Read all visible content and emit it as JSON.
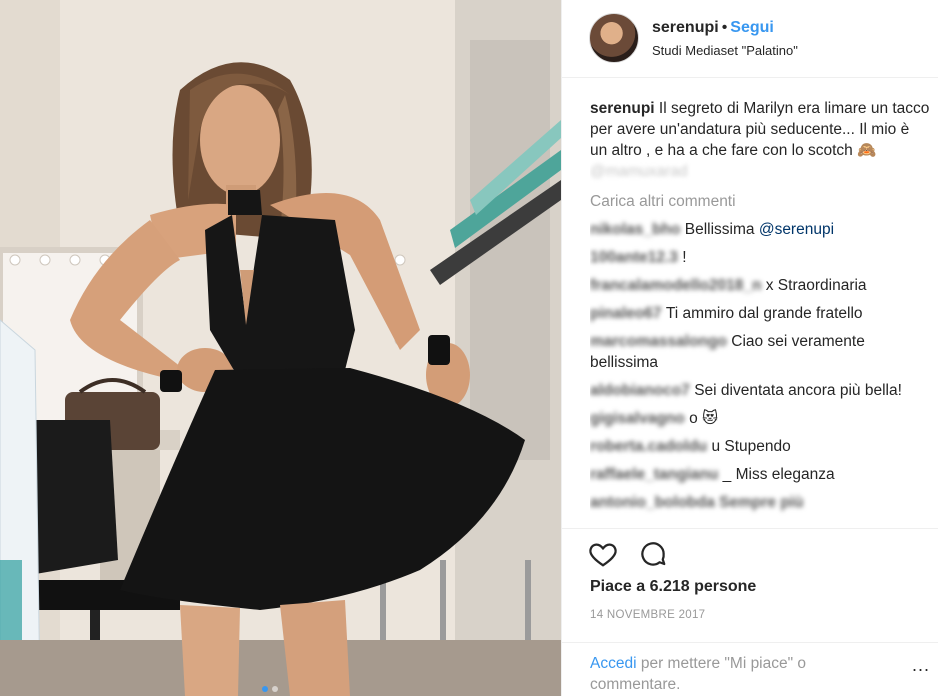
{
  "post": {
    "username": "serenupi",
    "bullet": "•",
    "follow_label": "Segui",
    "location": "Studi Mediaset \"Palatino\""
  },
  "caption": {
    "username": "serenupi",
    "text": "Il segreto di Marilyn era limare un tacco per avere un'andatura più seducente... Il mio è un altro , e ha a che fare con lo scotch 🙈",
    "mention_blurred": "@mamuxarad"
  },
  "load_more": "Carica altri commenti",
  "comments": [
    {
      "user": "nikolas_bho",
      "text": "Bellissima ",
      "mention": "@serenupi",
      "blurred_text": false
    },
    {
      "user": "100ante12.3",
      "text": "!",
      "mention": "",
      "blurred_text": false
    },
    {
      "user": "francalamodello2018_n",
      "text": "x Straordinaria",
      "mention": "",
      "blurred_text": false
    },
    {
      "user": "pinaleo67",
      "text": "Ti ammiro dal grande fratello",
      "mention": "",
      "blurred_text": false
    },
    {
      "user": "marcomassalongo",
      "text": "Ciao sei veramente bellissima",
      "mention": "",
      "blurred_text": false
    },
    {
      "user": "aldobianoco7",
      "text": "Sei diventata ancora più bella!",
      "mention": "",
      "blurred_text": false
    },
    {
      "user": "gigisalvagno",
      "text": "o 😻",
      "mention": "",
      "blurred_text": false
    },
    {
      "user": "roberta.cadoldu",
      "text": "u Stupendo",
      "mention": "",
      "blurred_text": false
    },
    {
      "user": "raffaele_tangianu",
      "text": "_ Miss eleganza",
      "mention": "",
      "blurred_text": false
    },
    {
      "user": "antonio_bolobda",
      "text": "Sempre più",
      "mention": "",
      "blurred_text": true
    }
  ],
  "actions": {
    "heart_icon": "heart-icon",
    "comment_icon": "comment-icon"
  },
  "likes": "Piace a 6.218 persone",
  "date": "14 NOVEMBRE 2017",
  "login": {
    "link": "Accedi",
    "text": " per mettere \"Mi piace\" o commentare.",
    "more": "..."
  },
  "colors": {
    "link": "#3897f0",
    "text": "#262626",
    "muted": "#999999"
  }
}
